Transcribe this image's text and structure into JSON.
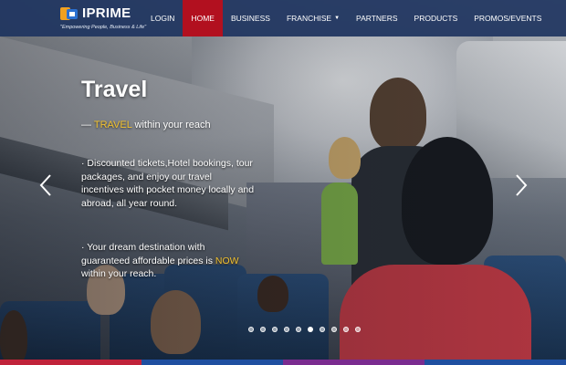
{
  "brand": {
    "name": "IPRIME",
    "tagline": "\"Empowering People, Business & Life\""
  },
  "nav": {
    "items": [
      {
        "label": "LOGIN"
      },
      {
        "label": "HOME"
      },
      {
        "label": "BUSINESS"
      },
      {
        "label": "FRANCHISE"
      },
      {
        "label": "PARTNERS"
      },
      {
        "label": "PRODUCTS"
      },
      {
        "label": "PROMOS/EVENTS"
      }
    ],
    "active": "HOME"
  },
  "slide": {
    "title": "Travel",
    "tagline_prefix": "— ",
    "tagline_highlight": "TRAVEL",
    "tagline_rest": " within your reach",
    "paragraph1": "· Discounted tickets,Hotel bookings, tour packages, and enjoy our travel incentives with pocket money locally and abroad, all year round.",
    "paragraph2_before": "· Your dream destination with guaranteed affordable prices is ",
    "paragraph2_highlight": "NOW",
    "paragraph2_after": " within your reach."
  },
  "carousel": {
    "slide_count": 10,
    "active_index": 5,
    "prev_icon": "chevron-left-icon",
    "next_icon": "chevron-right-icon"
  },
  "colors": {
    "navbar": "#1e345f",
    "active_nav": "#b2101f",
    "highlight": "#f2c230"
  }
}
